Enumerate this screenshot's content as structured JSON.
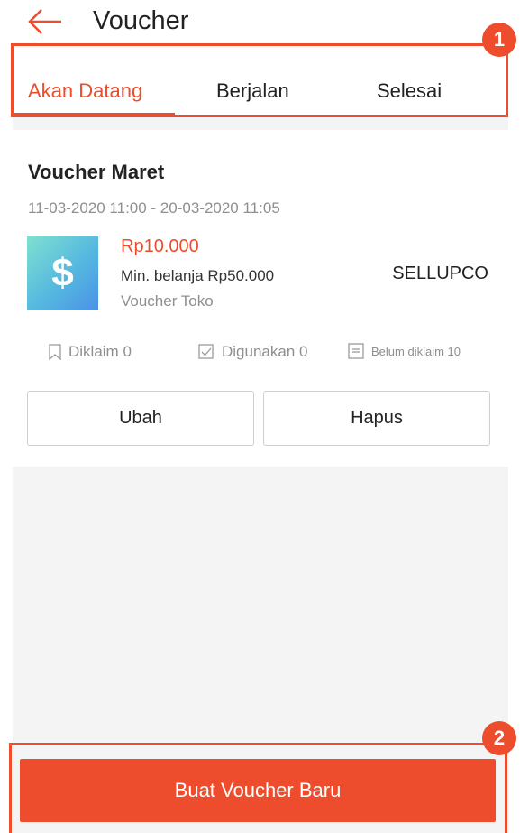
{
  "header": {
    "title": "Voucher",
    "back_icon": "arrow-left-icon"
  },
  "tabs": [
    {
      "label": "Akan Datang",
      "active": true
    },
    {
      "label": "Berjalan",
      "active": false
    },
    {
      "label": "Selesai",
      "active": false
    }
  ],
  "annotations": {
    "badge_one": "1",
    "badge_two": "2"
  },
  "voucher": {
    "name": "Voucher Maret",
    "period": "11-03-2020 11:00 - 20-03-2020 11:05",
    "amount": "Rp10.000",
    "min_spend": "Min. belanja Rp50.000",
    "type": "Voucher Toko",
    "code": "SELLUPCO",
    "stats": {
      "claimed": "Diklaim 0",
      "used": "Digunakan 0",
      "unclaimed": "Belum diklaim 10"
    },
    "edit_label": "Ubah",
    "delete_label": "Hapus"
  },
  "footer": {
    "create_label": "Buat Voucher Baru"
  },
  "colors": {
    "accent": "#ee4d2d",
    "muted_text": "#8f8f8f",
    "background_grey": "#f4f4f4"
  }
}
